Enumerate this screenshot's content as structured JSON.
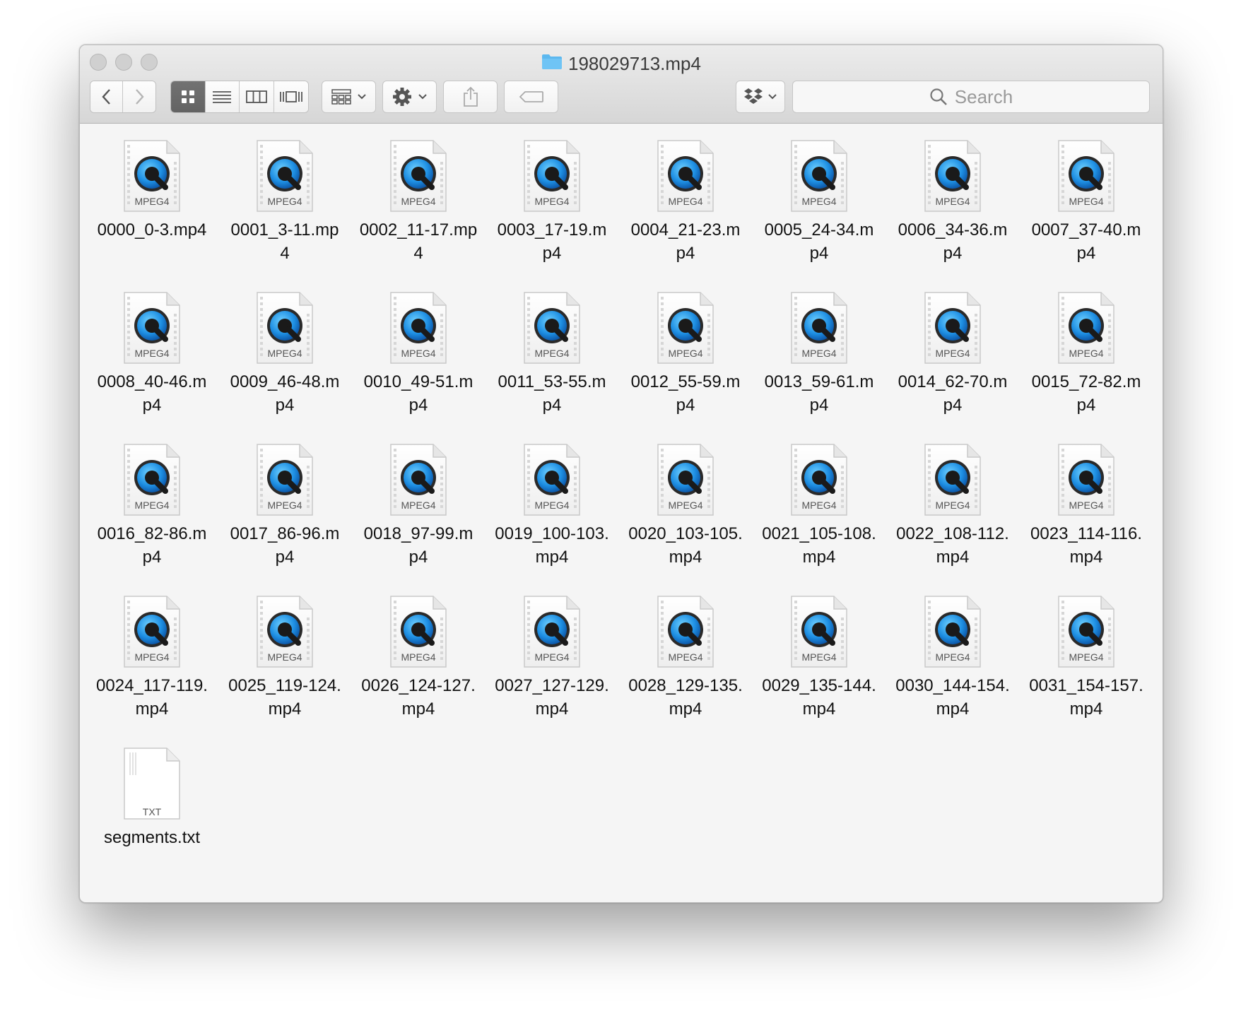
{
  "window": {
    "title": "198029713.mp4",
    "folder_icon": "folder-icon"
  },
  "toolbar": {
    "back_icon": "chevron-left-icon",
    "forward_icon": "chevron-right-icon",
    "view_modes": [
      "icon-view",
      "list-view",
      "column-view",
      "cover-flow-view"
    ],
    "active_view": "icon-view",
    "search_placeholder": "Search"
  },
  "icon_labels": {
    "mpeg4": "MPEG4",
    "txt": "TXT"
  },
  "files": [
    {
      "name": "0000_0-3.mp4",
      "type": "mpeg4"
    },
    {
      "name": "0001_3-11.mp\n4",
      "type": "mpeg4"
    },
    {
      "name": "0002_11-17.mp\n4",
      "type": "mpeg4"
    },
    {
      "name": "0003_17-19.m\np4",
      "type": "mpeg4"
    },
    {
      "name": "0004_21-23.m\np4",
      "type": "mpeg4"
    },
    {
      "name": "0005_24-34.m\np4",
      "type": "mpeg4"
    },
    {
      "name": "0006_34-36.m\np4",
      "type": "mpeg4"
    },
    {
      "name": "0007_37-40.m\np4",
      "type": "mpeg4"
    },
    {
      "name": "0008_40-46.m\np4",
      "type": "mpeg4"
    },
    {
      "name": "0009_46-48.m\np4",
      "type": "mpeg4"
    },
    {
      "name": "0010_49-51.m\np4",
      "type": "mpeg4"
    },
    {
      "name": "0011_53-55.m\np4",
      "type": "mpeg4"
    },
    {
      "name": "0012_55-59.m\np4",
      "type": "mpeg4"
    },
    {
      "name": "0013_59-61.m\np4",
      "type": "mpeg4"
    },
    {
      "name": "0014_62-70.m\np4",
      "type": "mpeg4"
    },
    {
      "name": "0015_72-82.m\np4",
      "type": "mpeg4"
    },
    {
      "name": "0016_82-86.m\np4",
      "type": "mpeg4"
    },
    {
      "name": "0017_86-96.m\np4",
      "type": "mpeg4"
    },
    {
      "name": "0018_97-99.m\np4",
      "type": "mpeg4"
    },
    {
      "name": "0019_100-103.\nmp4",
      "type": "mpeg4"
    },
    {
      "name": "0020_103-105.\nmp4",
      "type": "mpeg4"
    },
    {
      "name": "0021_105-108.\nmp4",
      "type": "mpeg4"
    },
    {
      "name": "0022_108-112.\nmp4",
      "type": "mpeg4"
    },
    {
      "name": "0023_114-116.\nmp4",
      "type": "mpeg4"
    },
    {
      "name": "0024_117-119.\nmp4",
      "type": "mpeg4"
    },
    {
      "name": "0025_119-124.\nmp4",
      "type": "mpeg4"
    },
    {
      "name": "0026_124-127.\nmp4",
      "type": "mpeg4"
    },
    {
      "name": "0027_127-129.\nmp4",
      "type": "mpeg4"
    },
    {
      "name": "0028_129-135.\nmp4",
      "type": "mpeg4"
    },
    {
      "name": "0029_135-144.\nmp4",
      "type": "mpeg4"
    },
    {
      "name": "0030_144-154.\nmp4",
      "type": "mpeg4"
    },
    {
      "name": "0031_154-157.\nmp4",
      "type": "mpeg4"
    },
    {
      "name": "segments.txt",
      "type": "txt"
    }
  ],
  "colors": {
    "quicktime_blue": "#1e8fe3",
    "window_bg": "#f5f5f5",
    "active_segment": "#6a6a6a"
  }
}
